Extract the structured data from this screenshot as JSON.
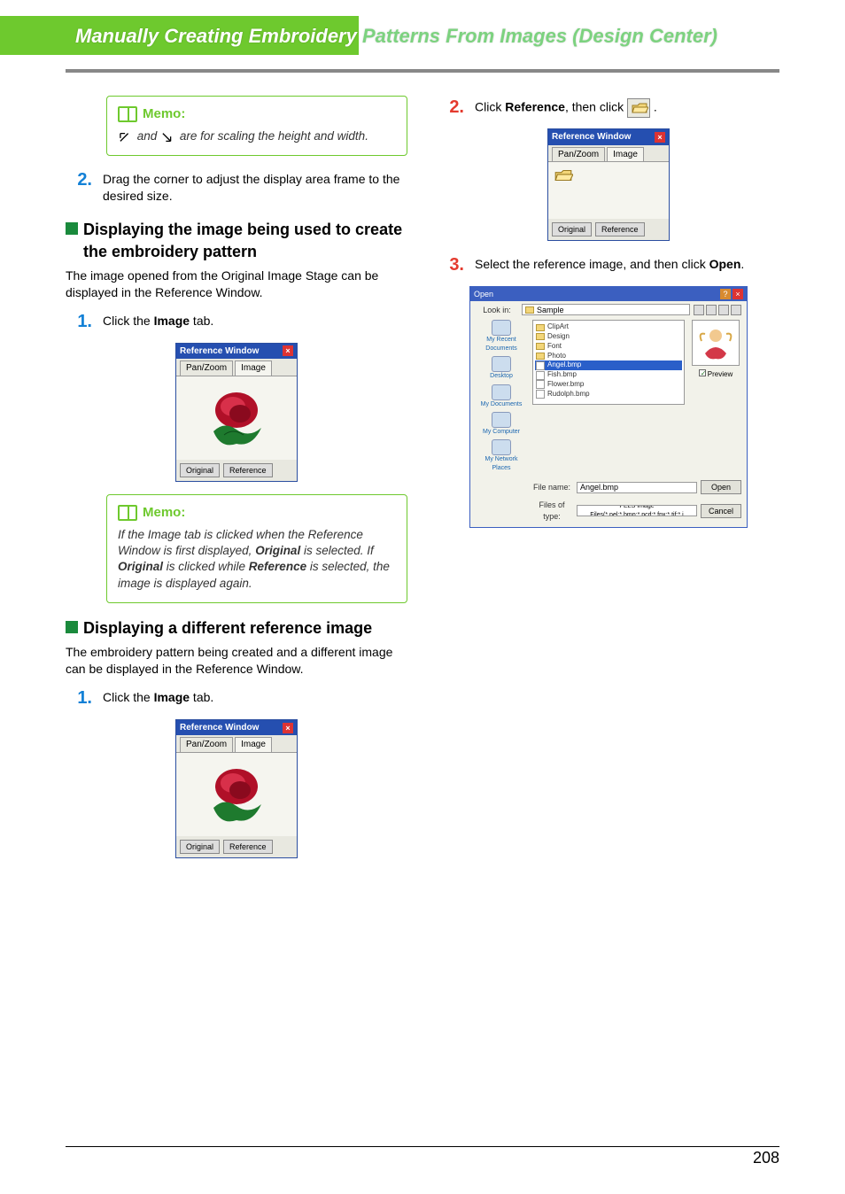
{
  "header": {
    "title_white": "Manually Creating Embroidery",
    "title_faded": "Patterns From Images (Design Center)"
  },
  "left": {
    "memo1": {
      "label": "Memo:",
      "body_prefix": "",
      "body_mid": " and ",
      "body_suffix": " are for scaling the height and width."
    },
    "step2": {
      "num": "2.",
      "text": "Drag the corner to adjust the display area frame to the desired size."
    },
    "sectionA": {
      "title": "Displaying the image being used to create the embroidery pattern",
      "p": "The image opened from the Original Image Stage can be displayed in the Reference Window."
    },
    "step1a": {
      "num": "1.",
      "text_a": "Click the ",
      "text_b": "Image",
      "text_c": " tab."
    },
    "refwin1": {
      "title": "Reference Window",
      "tab1": "Pan/Zoom",
      "tab2": "Image",
      "btn1": "Original",
      "btn2": "Reference"
    },
    "memo2": {
      "label": "Memo:",
      "line1a": "If the Image tab is clicked when the Reference Window is first displayed, ",
      "line1b": "Original",
      "line1c": " is selected. If ",
      "line1d": "Original",
      "line1e": " is clicked while ",
      "line1f": "Reference",
      "line1g": " is selected, the image is displayed again."
    },
    "sectionB": {
      "title": "Displaying a different reference image",
      "p": "The embroidery pattern being created and a different image can be displayed in the Reference Window."
    },
    "step1b": {
      "num": "1.",
      "text_a": "Click the ",
      "text_b": "Image",
      "text_c": " tab."
    },
    "refwin2": {
      "title": "Reference Window",
      "tab1": "Pan/Zoom",
      "tab2": "Image",
      "btn1": "Original",
      "btn2": "Reference"
    }
  },
  "right": {
    "step2": {
      "num": "2.",
      "text_a": "Click ",
      "text_b": "Reference",
      "text_c": ", then click "
    },
    "refwin3": {
      "title": "Reference Window",
      "tab1": "Pan/Zoom",
      "tab2": "Image",
      "btn1": "Original",
      "btn2": "Reference"
    },
    "step3": {
      "num": "3.",
      "text_a": "Select the reference image, and then click ",
      "text_b": "Open",
      "text_c": "."
    },
    "dialog": {
      "title": "Open",
      "lookin_label": "Look in:",
      "lookin_value": "Sample",
      "side": {
        "recent": "My Recent Documents",
        "desktop": "Desktop",
        "mydocs": "My Documents",
        "mycomp": "My Computer",
        "mynet": "My Network Places"
      },
      "list": {
        "f1": "ClipArt",
        "f2": "Design",
        "f3": "Font",
        "f4": "Photo",
        "sel": "Angel.bmp",
        "i1": "Fish.bmp",
        "i2": "Flower.bmp",
        "i3": "Rudolph.bmp"
      },
      "filename_label": "File name:",
      "filename_value": "Angel.bmp",
      "filetype_label": "Files of type:",
      "filetype_value": "PELS Image Files(*.pel;*.bmp;*.pcd;*.fpx;*.tif;*.j",
      "open_btn": "Open",
      "cancel_btn": "Cancel",
      "preview_chk": "Preview"
    }
  },
  "page_number": "208"
}
